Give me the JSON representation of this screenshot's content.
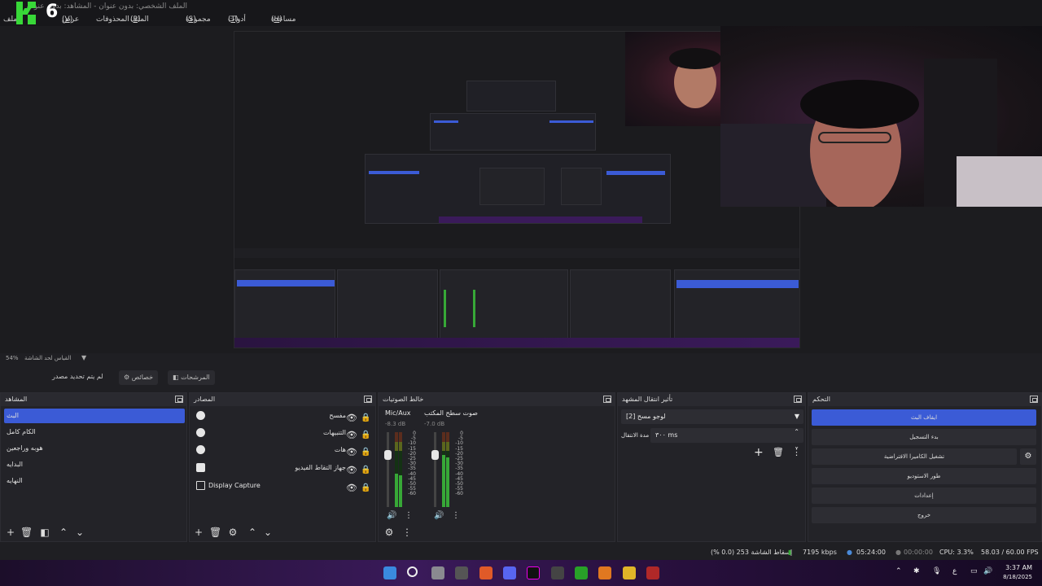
{
  "window": {
    "title": "الملف الشخصي: بدون عنوان - المشاهد: بدون عنوان"
  },
  "brand": {
    "digit": "6",
    "color": "#38d838"
  },
  "menu": [
    {
      "label": "مساعدة",
      "key": "H"
    },
    {
      "label": "أدوات",
      "key": "T"
    },
    {
      "label": "مجموعة المشاهد",
      "key": "S"
    },
    {
      "label": "الملف الشخصي",
      "key": "P"
    },
    {
      "label": "المحذوفات",
      "key": ""
    },
    {
      "label": "عرض",
      "key": "V"
    },
    {
      "label": "الملف",
      "key": ""
    }
  ],
  "zoom": {
    "level": "54%",
    "label": "القياس لحد الشاشة"
  },
  "source_toolbar": {
    "no_source": "لم يتم تحديد مصدر",
    "properties": "خصائص",
    "filters": "المرشحات"
  },
  "docks": {
    "scenes": {
      "title": "المشاهد",
      "items": [
        "البث",
        "الكام كامل",
        "هوبه وراجعين",
        "البدايه",
        "النهايه"
      ],
      "selected": 0
    },
    "sources": {
      "title": "المصادر",
      "items": [
        {
          "label": "مفسح",
          "icon": "browser-icon"
        },
        {
          "label": "التنبيهات",
          "icon": "browser-icon"
        },
        {
          "label": "هات",
          "icon": "browser-icon"
        },
        {
          "label": "جهاز التقاط الفيديو",
          "icon": "camera-icon"
        },
        {
          "label": "Display Capture",
          "icon": "monitor-icon"
        }
      ]
    },
    "mixer": {
      "title": "خالط الصوتيات",
      "channels": [
        {
          "name": "Mic/Aux",
          "db": "-8.3 dB",
          "level": 0.45
        },
        {
          "name": "صوت سطح المكتب",
          "db": "-7.0 dB",
          "level": 0.7
        }
      ],
      "ticks": [
        "0",
        "-5",
        "-10",
        "-15",
        "-20",
        "-25",
        "-30",
        "-35",
        "-40",
        "-45",
        "-50",
        "-55",
        "-60"
      ]
    },
    "transitions": {
      "title": "تأثير انتقال المشهد",
      "selected": "[2] لوجو مسح",
      "duration_label": "مدة الانتقال",
      "duration_value": "٣٠٠ ms"
    },
    "controls": {
      "title": "التحكم",
      "buttons": [
        "ايقاف البث",
        "بدء التسجيل",
        "تشغيل الكاميرا الافتراضية",
        "طور الاستوديو",
        "إعدادات",
        "خروج"
      ]
    }
  },
  "status": {
    "dropped": "إسقاط الشاشة 253 (0.0 %)",
    "bitrate": "7195 kbps",
    "stream_time": "05:24:00",
    "rec_time": "00:00:00",
    "cpu": "CPU: 3.3%",
    "fps": "58.03 / 60.00 FPS"
  },
  "taskbar": {
    "time": "3:37 AM",
    "date": "8/18/2025",
    "lang": "ع"
  },
  "colors": {
    "accent": "#3b5bd6",
    "meter_green": "#37a837",
    "meter_yellow": "#b2a628",
    "meter_red": "#b22828"
  }
}
